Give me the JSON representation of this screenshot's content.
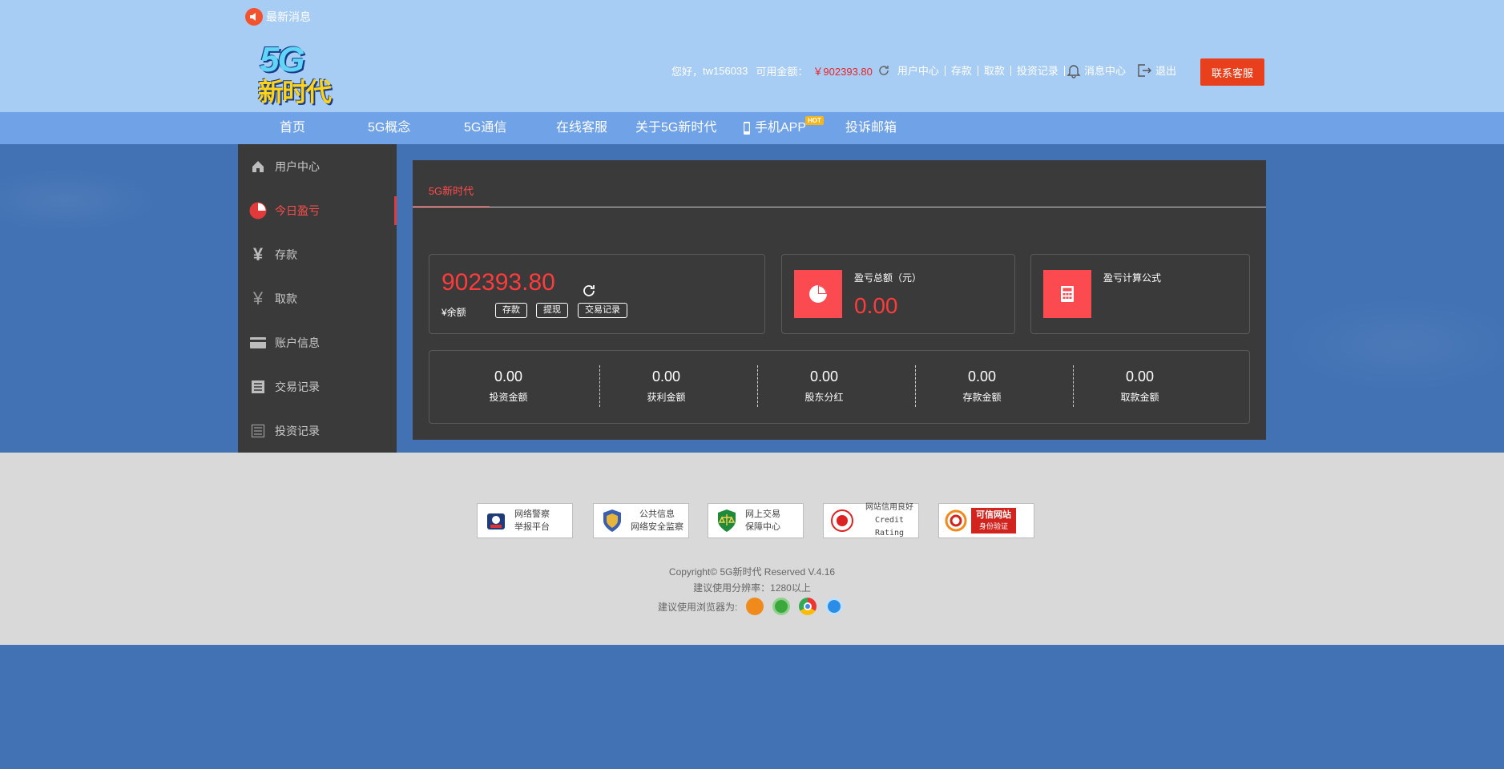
{
  "header": {
    "news_label": "最新消息",
    "logo_line1": "5G",
    "logo_line2": "新时代",
    "greeting": "您好，",
    "username": "tw156033",
    "balance_label": "可用金额：",
    "balance_value": "￥902393.80",
    "links": [
      "用户中心",
      "存款",
      "取款",
      "投资记录"
    ],
    "message_center": "消息中心",
    "logout": "退出",
    "contact_button": "联系客服"
  },
  "nav": {
    "items": [
      "首页",
      "5G概念",
      "5G通信",
      "在线客服",
      "关于5G新时代",
      "手机APP",
      "投诉邮箱"
    ],
    "hot_badge": "HOT"
  },
  "sidebar": {
    "items": [
      {
        "label": "用户中心",
        "icon": "home-icon"
      },
      {
        "label": "今日盈亏",
        "icon": "pie-chart-icon",
        "active": true
      },
      {
        "label": "存款",
        "icon": "yen-icon"
      },
      {
        "label": "取款",
        "icon": "yen-outline-icon"
      },
      {
        "label": "账户信息",
        "icon": "card-icon"
      },
      {
        "label": "交易记录",
        "icon": "list-icon"
      },
      {
        "label": "投资记录",
        "icon": "list-outline-icon"
      }
    ]
  },
  "main": {
    "tab_label": "5G新时代",
    "balance_card": {
      "amount": "902393.80",
      "label": "¥余额",
      "buttons": [
        "存款",
        "提现",
        "交易记录"
      ]
    },
    "profit_card": {
      "title": "盈亏总额（元）",
      "value": "0.00"
    },
    "formula_card": {
      "title": "盈亏计算公式"
    },
    "stats": [
      {
        "value": "0.00",
        "label": "投资金额"
      },
      {
        "value": "0.00",
        "label": "获利金额"
      },
      {
        "value": "0.00",
        "label": "股东分红"
      },
      {
        "value": "0.00",
        "label": "存款金额"
      },
      {
        "value": "0.00",
        "label": "取款金额"
      }
    ]
  },
  "footer": {
    "badges": [
      {
        "line1": "网络警察",
        "line2": "举报平台"
      },
      {
        "line1": "公共信息",
        "line2": "网络安全监察"
      },
      {
        "line1": "网上交易",
        "line2": "保障中心"
      },
      {
        "line1": "网站信用良好",
        "line2": "Credit Rating"
      },
      {
        "line1": "可信网站",
        "line2": "身份验证"
      }
    ],
    "copyright": "Copyright© 5G新时代 Reserved V.4.16",
    "resolution": "建议使用分辨率：1280以上",
    "browsers_label": "建议使用浏览器为:"
  },
  "colors": {
    "accent_red": "#e8401c",
    "value_red": "#ff3b3b",
    "panel": "#3a3a3a",
    "header": "#a8cdf4",
    "nav": "#6fa2e6"
  }
}
